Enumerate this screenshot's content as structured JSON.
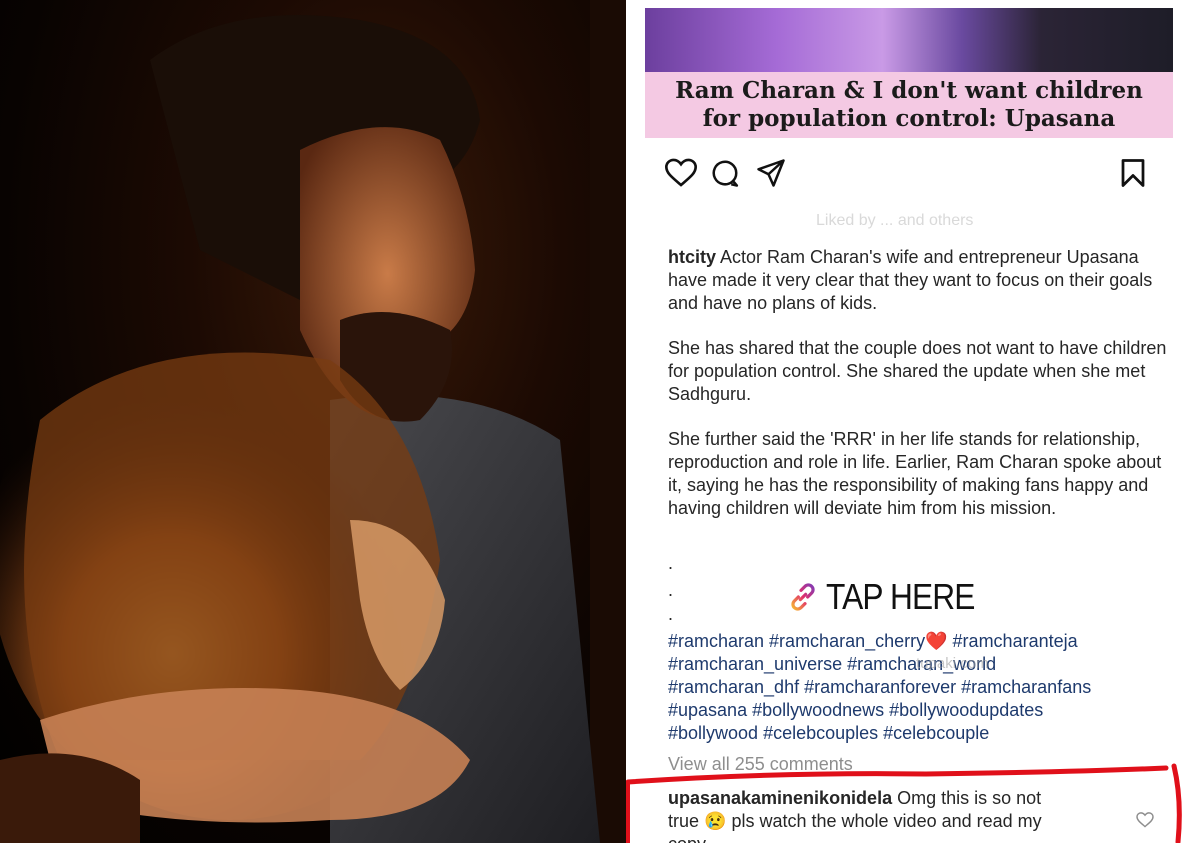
{
  "post": {
    "headline_line1": "Ram Charan & I don't want children",
    "headline_line2": "for population control: Upasana",
    "likes_faint": "Liked by ... and others",
    "caption_user": "htcity",
    "caption_p1": " Actor Ram Charan's wife and entrepreneur Upasana have made it very clear that they want to focus on their goals and have no plans of kids.",
    "caption_p2": "She has shared that the couple does not want to have children for population control. She shared the update when she met Sadhguru.",
    "caption_p3": "She further said the 'RRR' in her life stands for relationship, reproduction and role in life. Earlier, Ram Charan spoke about it, saying he has the responsibility of making fans happy and having children will deviate him from his mission.",
    "dot": ".",
    "tap_here": "TAP HERE",
    "hashtags_line1_a": "#ramcharan #ramcharan_cherry",
    "hashtags_heart": "❤️",
    "hashtags_line1_b": " #ramcharanteja",
    "hashtags_line2": "#ramcharan_universe #ramcharan_world",
    "hashtags_line3": "#ramcharan_dhf #ramcharanforever #ramcharanfans",
    "hashtags_line4": "#upasana #bollywoodnews #bollywoodupdates",
    "hashtags_line5": "#bollywood #celebcouples #celebcouple",
    "view_all_comments": "View all 255 comments",
    "comment_user": "upasanakaminenikonidela",
    "comment_text_1": " Omg this is so not",
    "comment_text_2": "true",
    "comment_emoji": "😢",
    "comment_text_3": " pls watch the whole video and read my",
    "comment_text_4": "copy",
    "watermark": "tupaki.com"
  },
  "icons": {
    "like": "heart-icon",
    "comment": "comment-icon",
    "share": "share-icon",
    "save": "bookmark-icon",
    "link": "link-icon"
  },
  "colors": {
    "headline_bg": "#f4c9e3",
    "hashtag": "#1e3a6d",
    "highlight_line": "#e0101a",
    "muted": "#8e8e8e"
  }
}
